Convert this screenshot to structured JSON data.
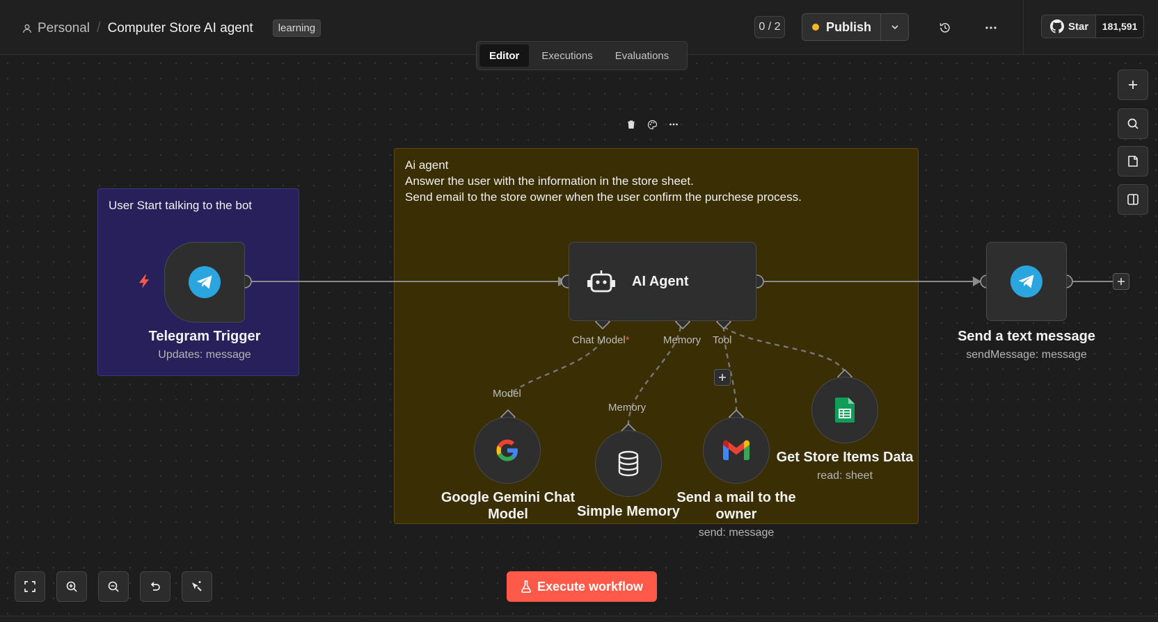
{
  "header": {
    "breadcrumb_project": "Personal",
    "breadcrumb_separator": "/",
    "workflow_title": "Computer Store AI agent",
    "tag": "learning",
    "counter": "0 / 2",
    "publish_label": "Publish",
    "github_star_label": "Star",
    "github_star_count": "181,591"
  },
  "tabs": [
    {
      "label": "Editor",
      "active": true
    },
    {
      "label": "Executions",
      "active": false
    },
    {
      "label": "Evaluations",
      "active": false
    }
  ],
  "stickies": {
    "trigger_note": "User Start talking to the bot",
    "agent_note_lines": [
      "Ai agent",
      "Answer the user with the information in the store sheet.",
      "Send email to the store owner when the user confirm the purchese process."
    ]
  },
  "nodes": {
    "telegram_trigger": {
      "title": "Telegram Trigger",
      "subtitle": "Updates: message"
    },
    "ai_agent": {
      "title": "AI Agent"
    },
    "send_text": {
      "title": "Send a text message",
      "subtitle": "sendMessage: message"
    },
    "gemini": {
      "title_lines": [
        "Google Gemini Chat",
        "Model"
      ]
    },
    "memory": {
      "title": "Simple Memory"
    },
    "gmail": {
      "title_lines": [
        "Send a mail to the",
        "owner"
      ],
      "subtitle": "send: message"
    },
    "sheets": {
      "title": "Get Store Items Data",
      "subtitle": "read: sheet"
    }
  },
  "ports": {
    "chat_model": "Chat Model",
    "required_mark": "*",
    "memory": "Memory",
    "tool": "Tool",
    "model": "Model",
    "memory_in": "Memory"
  },
  "footer": {
    "execute_label": "Execute workflow"
  },
  "colors": {
    "accent": "#ff5a49",
    "telegram": "#2aa5df",
    "publish_dot": "#f5b824",
    "trigger_bolt": "#ff5a49",
    "sticky_purple": "#28205a",
    "sticky_gold": "#3a2e04"
  },
  "icons": {
    "user": "user-icon",
    "chevron": "chevron-down-icon",
    "history": "history-icon",
    "more": "more-horizontal-icon",
    "github": "github-icon",
    "trash": "trash-icon",
    "palette": "palette-icon",
    "bolt": "lightning-bolt-icon",
    "telegram": "telegram-icon",
    "robot": "robot-icon",
    "google": "google-icon",
    "database": "database-icon",
    "gmail": "gmail-icon",
    "sheets": "google-sheets-icon",
    "plus": "plus-icon",
    "search": "search-icon",
    "sticky": "sticky-note-icon",
    "panel": "panel-icon",
    "fit": "fit-view-icon",
    "zoom_in": "zoom-in-icon",
    "zoom_out": "zoom-out-icon",
    "undo": "undo-icon",
    "tidy": "tidy-up-icon",
    "flask": "flask-icon"
  }
}
